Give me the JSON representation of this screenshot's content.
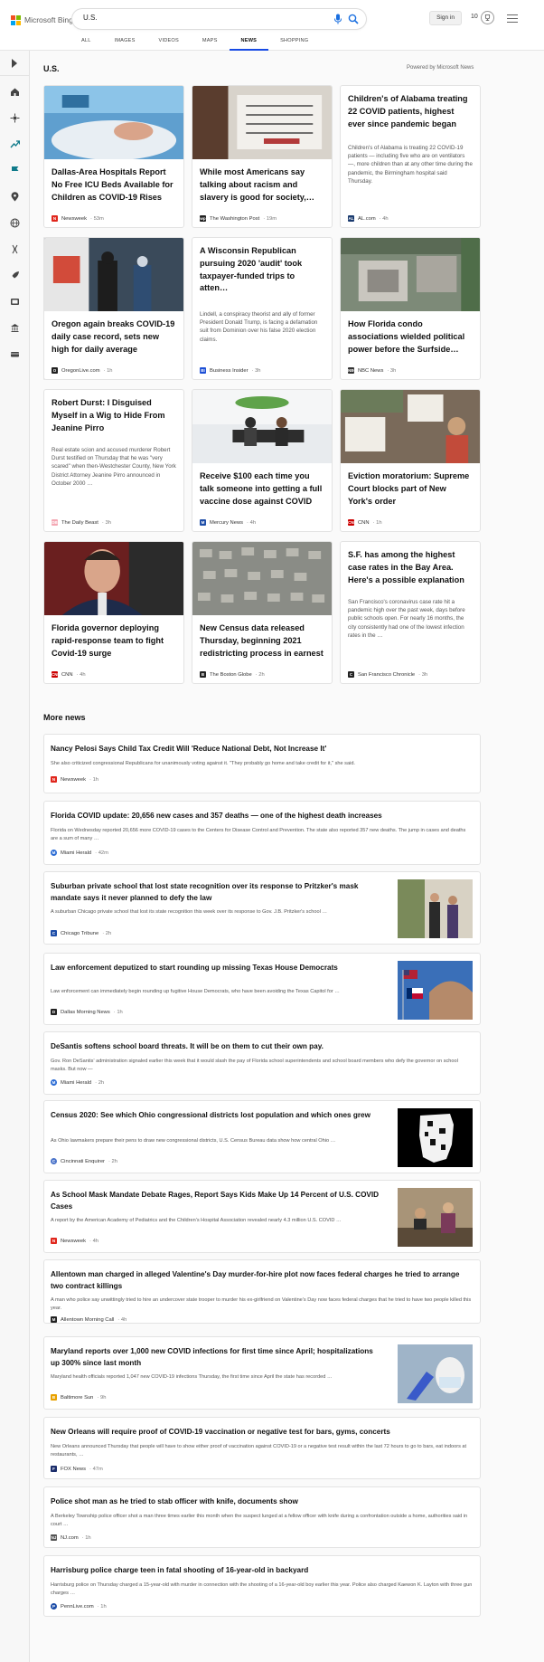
{
  "header": {
    "brand": "Microsoft Bing",
    "query": "U.S.",
    "sign_in": "Sign in",
    "rewards_points": "10",
    "tabs": [
      {
        "label": "ALL"
      },
      {
        "label": "IMAGES"
      },
      {
        "label": "VIDEOS"
      },
      {
        "label": "MAPS"
      },
      {
        "label": "NEWS"
      },
      {
        "label": "SHOPPING"
      }
    ],
    "active_tab": "NEWS"
  },
  "section": {
    "title": "U.S.",
    "powered_by": "Powered by Microsoft News"
  },
  "top_stories": [
    {
      "title": "Dallas-Area Hospitals Report No Free ICU Beds Available for Children as COVID-19 Rises",
      "source": "Newsweek",
      "age": "53m",
      "icon": "N",
      "icon_color": "#e0271d"
    },
    {
      "title": "While most Americans say talking about racism and slavery is good for society,…",
      "source": "The Washington Post",
      "age": "19m",
      "icon": "wp",
      "icon_color": "#222222"
    },
    {
      "title": "Children's of Alabama treating 22 COVID patients, highest ever since pandemic began",
      "snippet": "Children's of Alabama is treating 22 COVID-19 patients — including five who are on ventilators —, more children than at any other time during the pandemic, the Birmingham hospital said Thursday.",
      "source": "AL.com",
      "age": "4h",
      "icon": "AL",
      "icon_color": "#1b3b6f"
    },
    {
      "title": "Oregon again breaks COVID-19 daily case record, sets new high for daily average",
      "source": "OregonLive.com",
      "age": "1h",
      "icon": "O",
      "icon_color": "#222222"
    },
    {
      "title": "A Wisconsin Republican pursuing 2020 'audit' took taxpayer-funded trips to atten…",
      "snippet": "Lindell, a conspiracy theorist and ally of former President Donald Trump, is facing a defamation suit from Dominion over his false 2020 election claims.",
      "source": "Business Insider",
      "age": "3h",
      "icon": "BI",
      "icon_color": "#1d4fd6"
    },
    {
      "title": "How Florida condo associations wielded political power before the Surfside…",
      "source": "NBC News",
      "age": "3h",
      "icon": "NBC",
      "icon_color": "#333333"
    },
    {
      "title": "Robert Durst: I Disguised Myself in a Wig to Hide From Jeanine Pirro",
      "snippet": "Real estate scion and accused murderer Robert Durst testified on Thursday that he was \"very scared\" when then-Westchester County, New York District Attorney Jeanine Pirro announced in October 2000 …",
      "source": "The Daily Beast",
      "age": "3h",
      "icon": "DB",
      "icon_color": "#f4a8b4"
    },
    {
      "title": "Receive $100 each time you talk someone into getting a full vaccine dose against COVID",
      "source": "Mercury News",
      "age": "4h",
      "icon": "M",
      "icon_color": "#1f4ea8"
    },
    {
      "title": "Eviction moratorium: Supreme Court blocks part of New York's order",
      "source": "CNN",
      "age": "1h",
      "icon": "CNN",
      "icon_color": "#cc0000"
    },
    {
      "title": "Florida governor deploying rapid-response team to fight Covid-19 surge",
      "source": "CNN",
      "age": "4h",
      "icon": "CNN",
      "icon_color": "#cc0000"
    },
    {
      "title": "New Census data released Thursday, beginning 2021 redistricting process in earnest",
      "source": "The Boston Globe",
      "age": "2h",
      "icon": "B",
      "icon_color": "#222222"
    },
    {
      "title": "S.F. has among the highest case rates in the Bay Area. Here's a possible explanation",
      "snippet": "San Francisco's coronavirus case rate hit a pandemic high over the past week, days before public schools open. For nearly 16 months, the city consistently had one of the lowest infection rates in the …",
      "source": "San Francisco Chronicle",
      "age": "3h",
      "icon": "C",
      "icon_color": "#222222"
    }
  ],
  "more_news": {
    "title": "More news",
    "items": [
      {
        "title": "Nancy Pelosi Says Child Tax Credit Will 'Reduce National Debt, Not Increase It'",
        "snippet": "She also criticized congressional Republicans for unanimously voting against it. \"They probably go home and take credit for it,\" she said.",
        "source": "Newsweek",
        "age": "1h",
        "icon": "N",
        "icon_color": "#e0271d"
      },
      {
        "title": "Florida COVID update: 20,656 new cases and 357 deaths — one of the highest death increases",
        "snippet": "Florida on Wednesday reported 20,656 more COVID-19 cases to the Centers for Disease Control and Prevention. The state also reported 357 new deaths. The jump in cases and deaths are a sum of many …",
        "source": "Miami Herald",
        "age": "42m",
        "icon": "M",
        "icon_color": "#2b6cd4"
      },
      {
        "title": "Suburban private school that lost state recognition over its response to Pritzker's mask mandate says it never planned to defy the law",
        "snippet": "A suburban Chicago private school that lost its state recognition this week over its response to Gov. J.B. Pritzker's school …",
        "source": "Chicago Tribune",
        "age": "2h",
        "icon": "C",
        "icon_color": "#1c4da8"
      },
      {
        "title": "Law enforcement deputized to start rounding up missing Texas House Democrats",
        "snippet": "Law enforcement can immediately begin rounding up fugitive House Democrats, who have been avoiding the Texas Capitol for …",
        "source": "Dallas Morning News",
        "age": "1h",
        "icon": "D",
        "icon_color": "#222222"
      },
      {
        "title": "DeSantis softens school board threats. It will be on them to cut their own pay.",
        "snippet": "Gov. Ron DeSantis' administration signaled earlier this week that it would slash the pay of Florida school superintendents and school board members who defy the governor on school masks. But now —",
        "source": "Miami Herald",
        "age": "2h",
        "icon": "M",
        "icon_color": "#2b6cd4"
      },
      {
        "title": "Census 2020: See which Ohio congressional districts lost population and which ones grew",
        "snippet": "As Ohio lawmakers prepare their pens to draw new congressional districts, U.S. Census Bureau data show how central Ohio …",
        "source": "Cincinnati Enquirer",
        "age": "2h",
        "icon": "C",
        "icon_color": "#4a73c9"
      },
      {
        "title": "As School Mask Mandate Debate Rages, Report Says Kids Make Up 14 Percent of U.S. COVID Cases",
        "snippet": "A report by the American Academy of Pediatrics and the Children's Hospital Association revealed nearly 4.3 million U.S. COVID …",
        "source": "Newsweek",
        "age": "4h",
        "icon": "N",
        "icon_color": "#e0271d"
      },
      {
        "title": "Allentown man charged in alleged Valentine's Day murder-for-hire plot now faces federal charges he tried to arrange two contract killings",
        "snippet": "A man who police say unwittingly tried to hire an undercover state trooper to murder his ex-girlfriend on Valentine's Day now faces federal charges that he tried to have two people killed this year.",
        "source": "Allentown Morning Call",
        "age": "4h",
        "icon": "M",
        "icon_color": "#222222"
      },
      {
        "title": "Maryland reports over 1,000 new COVID infections for first time since April; hospitalizations up 300% since last month",
        "snippet": "Maryland health officials reported 1,047 new COVID-19 infections Thursday, the first time since April the state has recorded …",
        "source": "Baltimore Sun",
        "age": "9h",
        "icon": "B",
        "icon_color": "#e8a100"
      },
      {
        "title": "New Orleans will require proof of COVID-19 vaccination or negative test for bars, gyms, concerts",
        "snippet": "New Orleans announced Thursday that people will have to show either proof of vaccination against COVID-19 or a negative test result within the last 72 hours to go to bars, eat indoors at restaurants, …",
        "source": "FOX News",
        "age": "47m",
        "icon": "F",
        "icon_color": "#1b2d6b"
      },
      {
        "title": "Police shot man as he tried to stab officer with knife, documents show",
        "snippet": "A Berkeley Township police officer shot a man three times earlier this month when the suspect lunged at a fellow officer with knife during a confrontation outside a home, authorities said in court …",
        "source": "NJ.com",
        "age": "1h",
        "icon": "NJ",
        "icon_color": "#555555"
      },
      {
        "title": "Harrisburg police charge teen in fatal shooting of 16-year-old in backyard",
        "snippet": "Harrisburg police on Thursday charged a 15-year-old with murder in connection with the shooting of a 16-year-old boy earlier this year. Police also charged Kaewon K. Layton with three gun charges …",
        "source": "PennLive.com",
        "age": "1h",
        "icon": "P",
        "icon_color": "#1c4da8"
      }
    ]
  }
}
